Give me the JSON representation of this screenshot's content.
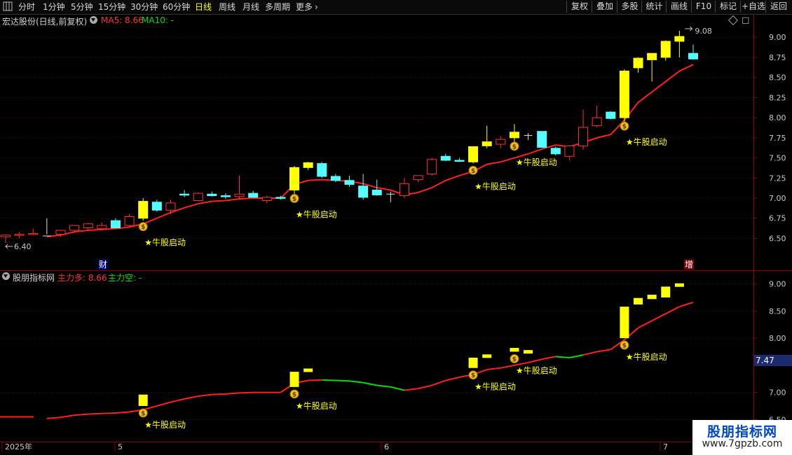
{
  "toolbar": {
    "nav_icon": "grid-icon",
    "period_tabs": [
      "分时",
      "1分钟",
      "5分钟",
      "15分钟",
      "30分钟",
      "60分钟",
      "日线",
      "周线",
      "月线",
      "多周期",
      "更多"
    ],
    "active_tab": "日线",
    "more_arrow": "chevron-right-icon",
    "right_buttons": [
      "复权",
      "叠加",
      "多股",
      "统计",
      "画线",
      "F10",
      "标记",
      "+自选",
      "返回"
    ]
  },
  "main_panel": {
    "title": "宏达股份(日线,前复权)",
    "ma5_label": "MA5: 8.66",
    "ma10_label": "MA10: -",
    "high_marker": "9.08",
    "low_marker": "6.40",
    "y_ticks": [
      "9.00",
      "8.75",
      "8.50",
      "8.25",
      "8.00",
      "7.75",
      "7.50",
      "7.25",
      "7.00",
      "6.75",
      "6.50"
    ],
    "event_badges": [
      "财",
      "增"
    ],
    "signal_text": "★牛股启动"
  },
  "indicator_panel": {
    "title": "股朋指标网",
    "bull_label": "主力多: 8.66",
    "bear_label": "主力空: -",
    "y_ticks": [
      "9.00",
      "8.50",
      "8.00",
      "7.00",
      "6.50"
    ],
    "current_value": "7.47",
    "signal_text": "★牛股启动"
  },
  "x_axis": {
    "labels": [
      "2025年",
      "5",
      "6",
      "7"
    ]
  },
  "watermark": {
    "title": "股朋指标网",
    "url": "www.7gpzb.com"
  },
  "colors": {
    "up": "#ff3232",
    "down": "#54ffff",
    "signal_bar": "#ffff00",
    "ma_line": "#ff2020",
    "bear_line": "#00e000",
    "axis": "#8b0000"
  },
  "chart_data": {
    "type": "candlestick",
    "title": "宏达股份(日线,前复权)",
    "high": 9.08,
    "low": 6.4,
    "y_range": [
      6.33,
      9.15
    ],
    "candles": [
      {
        "o": 6.52,
        "h": 6.55,
        "l": 6.44,
        "c": 6.54
      },
      {
        "o": 6.54,
        "h": 6.58,
        "l": 6.5,
        "c": 6.55
      },
      {
        "o": 6.56,
        "h": 6.62,
        "l": 6.54,
        "c": 6.56
      },
      {
        "o": 6.6,
        "h": 6.75,
        "l": 6.55,
        "c": 6.53
      },
      {
        "o": 6.55,
        "h": 6.6,
        "l": 6.52,
        "c": 6.6
      },
      {
        "o": 6.6,
        "h": 6.65,
        "l": 6.57,
        "c": 6.66
      },
      {
        "o": 6.63,
        "h": 6.69,
        "l": 6.6,
        "c": 6.68
      },
      {
        "o": 6.62,
        "h": 6.7,
        "l": 6.6,
        "c": 6.66
      },
      {
        "o": 6.72,
        "h": 6.75,
        "l": 6.66,
        "c": 6.63
      },
      {
        "o": 6.66,
        "h": 6.8,
        "l": 6.64,
        "c": 6.77
      },
      {
        "o": 6.75,
        "h": 7.0,
        "l": 6.72,
        "c": 6.96
      },
      {
        "o": 6.95,
        "h": 6.98,
        "l": 6.83,
        "c": 6.85
      },
      {
        "o": 6.85,
        "h": 6.98,
        "l": 6.8,
        "c": 6.94
      },
      {
        "o": 7.05,
        "h": 7.1,
        "l": 7.01,
        "c": 7.04
      },
      {
        "o": 6.97,
        "h": 7.07,
        "l": 6.96,
        "c": 7.06
      },
      {
        "o": 7.05,
        "h": 7.08,
        "l": 7.02,
        "c": 7.03
      },
      {
        "o": 7.03,
        "h": 7.06,
        "l": 6.99,
        "c": 7.02
      },
      {
        "o": 7.02,
        "h": 7.28,
        "l": 6.98,
        "c": 7.05
      },
      {
        "o": 7.06,
        "h": 7.09,
        "l": 7.01,
        "c": 7.01
      },
      {
        "o": 6.97,
        "h": 7.03,
        "l": 6.94,
        "c": 7.01
      },
      {
        "o": 7.01,
        "h": 7.03,
        "l": 6.98,
        "c": 7.0
      },
      {
        "o": 7.1,
        "h": 7.4,
        "l": 7.05,
        "c": 7.38
      },
      {
        "o": 7.38,
        "h": 7.45,
        "l": 7.35,
        "c": 7.44
      },
      {
        "o": 7.43,
        "h": 7.45,
        "l": 7.25,
        "c": 7.27
      },
      {
        "o": 7.27,
        "h": 7.3,
        "l": 7.2,
        "c": 7.22
      },
      {
        "o": 7.22,
        "h": 7.28,
        "l": 7.14,
        "c": 7.17
      },
      {
        "o": 7.15,
        "h": 7.3,
        "l": 6.98,
        "c": 7.01
      },
      {
        "o": 7.1,
        "h": 7.23,
        "l": 7.03,
        "c": 7.04
      },
      {
        "o": 7.05,
        "h": 7.08,
        "l": 6.95,
        "c": 7.05
      },
      {
        "o": 7.03,
        "h": 7.25,
        "l": 7.0,
        "c": 7.18
      },
      {
        "o": 7.23,
        "h": 7.28,
        "l": 7.2,
        "c": 7.28
      },
      {
        "o": 7.3,
        "h": 7.5,
        "l": 7.28,
        "c": 7.48
      },
      {
        "o": 7.52,
        "h": 7.55,
        "l": 7.46,
        "c": 7.47
      },
      {
        "o": 7.47,
        "h": 7.5,
        "l": 7.45,
        "c": 7.46
      },
      {
        "o": 7.45,
        "h": 7.62,
        "l": 7.43,
        "c": 7.64
      },
      {
        "o": 7.65,
        "h": 7.9,
        "l": 7.62,
        "c": 7.7
      },
      {
        "o": 7.67,
        "h": 7.77,
        "l": 7.62,
        "c": 7.73
      },
      {
        "o": 7.75,
        "h": 7.92,
        "l": 7.7,
        "c": 7.82
      },
      {
        "o": 7.78,
        "h": 7.81,
        "l": 7.72,
        "c": 7.78
      },
      {
        "o": 7.83,
        "h": 7.83,
        "l": 7.63,
        "c": 7.63
      },
      {
        "o": 7.62,
        "h": 7.64,
        "l": 7.53,
        "c": 7.55
      },
      {
        "o": 7.52,
        "h": 7.66,
        "l": 7.47,
        "c": 7.65
      },
      {
        "o": 7.65,
        "h": 8.1,
        "l": 7.6,
        "c": 7.88
      },
      {
        "o": 7.9,
        "h": 8.15,
        "l": 7.88,
        "c": 8.0
      },
      {
        "o": 8.07,
        "h": 8.08,
        "l": 7.98,
        "c": 7.99
      },
      {
        "o": 8.0,
        "h": 8.6,
        "l": 7.95,
        "c": 8.58
      },
      {
        "o": 8.62,
        "h": 8.75,
        "l": 8.56,
        "c": 8.74
      },
      {
        "o": 8.72,
        "h": 8.8,
        "l": 8.45,
        "c": 8.8
      },
      {
        "o": 8.75,
        "h": 8.96,
        "l": 8.71,
        "c": 8.95
      },
      {
        "o": 8.95,
        "h": 9.08,
        "l": 8.75,
        "c": 9.01
      },
      {
        "o": 8.8,
        "h": 8.91,
        "l": 8.72,
        "c": 8.73
      }
    ],
    "signal_candles": [
      10,
      21,
      22,
      34,
      35,
      37,
      38,
      45,
      46,
      47,
      48,
      49
    ],
    "cross_candles": [
      3,
      28,
      38
    ],
    "start_signals": [
      10,
      21,
      34,
      37,
      45
    ],
    "ma5": [
      [
        3,
        6.52
      ],
      [
        4,
        6.54
      ],
      [
        5,
        6.58
      ],
      [
        6,
        6.6
      ],
      [
        7,
        6.61
      ],
      [
        8,
        6.62
      ],
      [
        9,
        6.64
      ],
      [
        10,
        6.68
      ],
      [
        11,
        6.75
      ],
      [
        12,
        6.82
      ],
      [
        13,
        6.88
      ],
      [
        14,
        6.93
      ],
      [
        15,
        6.96
      ],
      [
        16,
        6.97
      ],
      [
        17,
        6.99
      ],
      [
        18,
        7.0
      ],
      [
        19,
        7.0
      ],
      [
        20,
        7.0
      ],
      [
        21,
        7.17
      ],
      [
        22,
        7.22
      ],
      [
        23,
        7.23
      ],
      [
        24,
        7.22
      ],
      [
        25,
        7.21
      ],
      [
        26,
        7.18
      ],
      [
        27,
        7.13
      ],
      [
        28,
        7.1
      ],
      [
        29,
        7.04
      ],
      [
        30,
        7.07
      ],
      [
        31,
        7.13
      ],
      [
        32,
        7.22
      ],
      [
        33,
        7.28
      ],
      [
        34,
        7.33
      ],
      [
        35,
        7.42
      ],
      [
        36,
        7.45
      ],
      [
        37,
        7.5
      ],
      [
        38,
        7.55
      ],
      [
        39,
        7.61
      ],
      [
        40,
        7.66
      ],
      [
        41,
        7.64
      ],
      [
        42,
        7.69
      ],
      [
        43,
        7.75
      ],
      [
        44,
        7.79
      ],
      [
        45,
        7.97
      ],
      [
        46,
        8.19
      ],
      [
        47,
        8.32
      ],
      [
        48,
        8.45
      ],
      [
        49,
        8.58
      ],
      [
        50,
        8.66
      ]
    ]
  }
}
